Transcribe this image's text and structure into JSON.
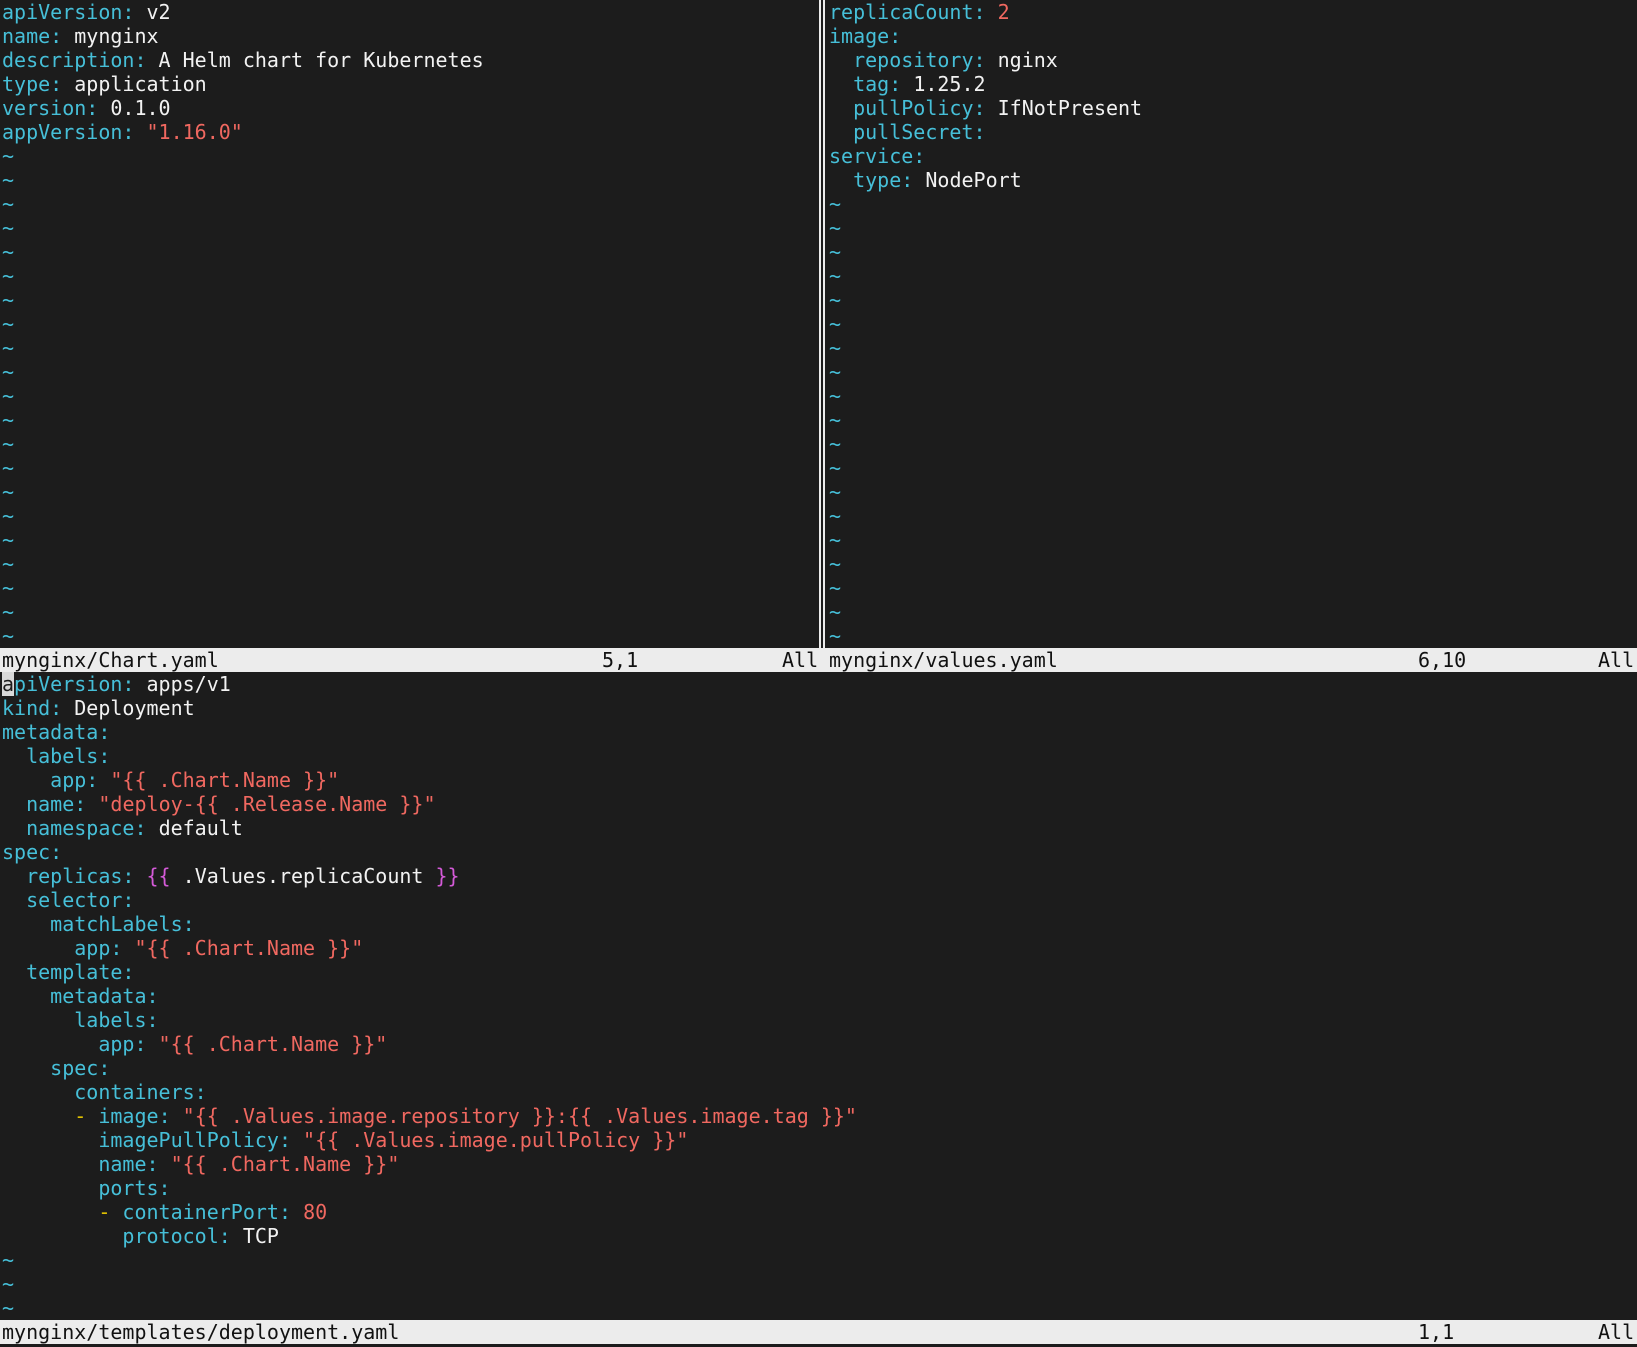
{
  "panes": {
    "chart": {
      "filename": "mynginx/Chart.yaml",
      "position": "5,1",
      "scroll": "All",
      "tildes": 21,
      "lines": [
        [
          {
            "t": "k",
            "x": "apiVersion"
          },
          {
            "t": "k",
            "x": ": "
          },
          {
            "t": "v",
            "x": "v2"
          }
        ],
        [
          {
            "t": "k",
            "x": "name"
          },
          {
            "t": "k",
            "x": ": "
          },
          {
            "t": "v",
            "x": "mynginx"
          }
        ],
        [
          {
            "t": "k",
            "x": "description"
          },
          {
            "t": "k",
            "x": ": "
          },
          {
            "t": "v",
            "x": "A Helm chart for Kubernetes"
          }
        ],
        [
          {
            "t": "k",
            "x": "type"
          },
          {
            "t": "k",
            "x": ": "
          },
          {
            "t": "v",
            "x": "application"
          }
        ],
        [
          {
            "t": "k",
            "x": "version"
          },
          {
            "t": "k",
            "x": ": "
          },
          {
            "t": "v",
            "x": "0.1.0"
          }
        ],
        [
          {
            "t": "k",
            "x": "appVersion"
          },
          {
            "t": "k",
            "x": ": "
          },
          {
            "t": "s",
            "x": "\"1.16.0\""
          }
        ]
      ]
    },
    "values": {
      "filename": "mynginx/values.yaml",
      "position": "6,10",
      "scroll": "All",
      "tildes": 19,
      "lines": [
        [
          {
            "t": "k",
            "x": "replicaCount"
          },
          {
            "t": "k",
            "x": ": "
          },
          {
            "t": "n",
            "x": "2"
          }
        ],
        [
          {
            "t": "k",
            "x": "image"
          },
          {
            "t": "k",
            "x": ":"
          }
        ],
        [
          {
            "t": "v",
            "x": "  "
          },
          {
            "t": "k",
            "x": "repository"
          },
          {
            "t": "k",
            "x": ": "
          },
          {
            "t": "v",
            "x": "nginx"
          }
        ],
        [
          {
            "t": "v",
            "x": "  "
          },
          {
            "t": "k",
            "x": "tag"
          },
          {
            "t": "k",
            "x": ": "
          },
          {
            "t": "v",
            "x": "1.25.2"
          }
        ],
        [
          {
            "t": "v",
            "x": "  "
          },
          {
            "t": "k",
            "x": "pullPolicy"
          },
          {
            "t": "k",
            "x": ": "
          },
          {
            "t": "v",
            "x": "IfNotPresent"
          }
        ],
        [
          {
            "t": "v",
            "x": "  "
          },
          {
            "t": "k",
            "x": "pullSecret"
          },
          {
            "t": "k",
            "x": ":"
          }
        ],
        [
          {
            "t": "k",
            "x": "service"
          },
          {
            "t": "k",
            "x": ":"
          }
        ],
        [
          {
            "t": "v",
            "x": "  "
          },
          {
            "t": "k",
            "x": "type"
          },
          {
            "t": "k",
            "x": ": "
          },
          {
            "t": "v",
            "x": "NodePort"
          }
        ]
      ]
    },
    "deployment": {
      "filename": "mynginx/templates/deployment.yaml",
      "position": "1,1",
      "scroll": "All",
      "tildes": 3,
      "lines": [
        [
          {
            "t": "c",
            "x": "a"
          },
          {
            "t": "k",
            "x": "piVersion"
          },
          {
            "t": "k",
            "x": ": "
          },
          {
            "t": "v",
            "x": "apps/v1"
          }
        ],
        [
          {
            "t": "k",
            "x": "kind"
          },
          {
            "t": "k",
            "x": ": "
          },
          {
            "t": "v",
            "x": "Deployment"
          }
        ],
        [
          {
            "t": "k",
            "x": "metadata"
          },
          {
            "t": "k",
            "x": ":"
          }
        ],
        [
          {
            "t": "v",
            "x": "  "
          },
          {
            "t": "k",
            "x": "labels"
          },
          {
            "t": "k",
            "x": ":"
          }
        ],
        [
          {
            "t": "v",
            "x": "    "
          },
          {
            "t": "k",
            "x": "app"
          },
          {
            "t": "k",
            "x": ": "
          },
          {
            "t": "s",
            "x": "\"{{ .Chart.Name }}\""
          }
        ],
        [
          {
            "t": "v",
            "x": "  "
          },
          {
            "t": "k",
            "x": "name"
          },
          {
            "t": "k",
            "x": ": "
          },
          {
            "t": "s",
            "x": "\"deploy-{{ .Release.Name }}\""
          }
        ],
        [
          {
            "t": "v",
            "x": "  "
          },
          {
            "t": "k",
            "x": "namespace"
          },
          {
            "t": "k",
            "x": ": "
          },
          {
            "t": "v",
            "x": "default"
          }
        ],
        [
          {
            "t": "k",
            "x": "spec"
          },
          {
            "t": "k",
            "x": ":"
          }
        ],
        [
          {
            "t": "v",
            "x": "  "
          },
          {
            "t": "k",
            "x": "replicas"
          },
          {
            "t": "k",
            "x": ": "
          },
          {
            "t": "b",
            "x": "{{"
          },
          {
            "t": "v",
            "x": " .Values.replicaCount "
          },
          {
            "t": "b",
            "x": "}}"
          }
        ],
        [
          {
            "t": "v",
            "x": "  "
          },
          {
            "t": "k",
            "x": "selector"
          },
          {
            "t": "k",
            "x": ":"
          }
        ],
        [
          {
            "t": "v",
            "x": "    "
          },
          {
            "t": "k",
            "x": "matchLabels"
          },
          {
            "t": "k",
            "x": ":"
          }
        ],
        [
          {
            "t": "v",
            "x": "      "
          },
          {
            "t": "k",
            "x": "app"
          },
          {
            "t": "k",
            "x": ": "
          },
          {
            "t": "s",
            "x": "\"{{ .Chart.Name }}\""
          }
        ],
        [
          {
            "t": "v",
            "x": "  "
          },
          {
            "t": "k",
            "x": "template"
          },
          {
            "t": "k",
            "x": ":"
          }
        ],
        [
          {
            "t": "v",
            "x": "    "
          },
          {
            "t": "k",
            "x": "metadata"
          },
          {
            "t": "k",
            "x": ":"
          }
        ],
        [
          {
            "t": "v",
            "x": "      "
          },
          {
            "t": "k",
            "x": "labels"
          },
          {
            "t": "k",
            "x": ":"
          }
        ],
        [
          {
            "t": "v",
            "x": "        "
          },
          {
            "t": "k",
            "x": "app"
          },
          {
            "t": "k",
            "x": ": "
          },
          {
            "t": "s",
            "x": "\"{{ .Chart.Name }}\""
          }
        ],
        [
          {
            "t": "v",
            "x": "    "
          },
          {
            "t": "k",
            "x": "spec"
          },
          {
            "t": "k",
            "x": ":"
          }
        ],
        [
          {
            "t": "v",
            "x": "      "
          },
          {
            "t": "k",
            "x": "containers"
          },
          {
            "t": "k",
            "x": ":"
          }
        ],
        [
          {
            "t": "v",
            "x": "      "
          },
          {
            "t": "d",
            "x": "- "
          },
          {
            "t": "k",
            "x": "image"
          },
          {
            "t": "k",
            "x": ": "
          },
          {
            "t": "s",
            "x": "\"{{ .Values.image.repository }}:{{ .Values.image.tag }}\""
          }
        ],
        [
          {
            "t": "v",
            "x": "        "
          },
          {
            "t": "k",
            "x": "imagePullPolicy"
          },
          {
            "t": "k",
            "x": ": "
          },
          {
            "t": "s",
            "x": "\"{{ .Values.image.pullPolicy }}\""
          }
        ],
        [
          {
            "t": "v",
            "x": "        "
          },
          {
            "t": "k",
            "x": "name"
          },
          {
            "t": "k",
            "x": ": "
          },
          {
            "t": "s",
            "x": "\"{{ .Chart.Name }}\""
          }
        ],
        [
          {
            "t": "v",
            "x": "        "
          },
          {
            "t": "k",
            "x": "ports"
          },
          {
            "t": "k",
            "x": ":"
          }
        ],
        [
          {
            "t": "v",
            "x": "        "
          },
          {
            "t": "d",
            "x": "- "
          },
          {
            "t": "k",
            "x": "containerPort"
          },
          {
            "t": "k",
            "x": ": "
          },
          {
            "t": "n",
            "x": "80"
          }
        ],
        [
          {
            "t": "v",
            "x": "          "
          },
          {
            "t": "k",
            "x": "protocol"
          },
          {
            "t": "k",
            "x": ": "
          },
          {
            "t": "v",
            "x": "TCP"
          }
        ]
      ]
    }
  },
  "colors": {
    "background": "#1c1c1c",
    "key": "#46bfd8",
    "plain": "#f2f2f2",
    "string": "#f06860",
    "number": "#f06860",
    "brace": "#d45ad8",
    "dash": "#e0c000",
    "statusbar_bg": "#ececec"
  }
}
